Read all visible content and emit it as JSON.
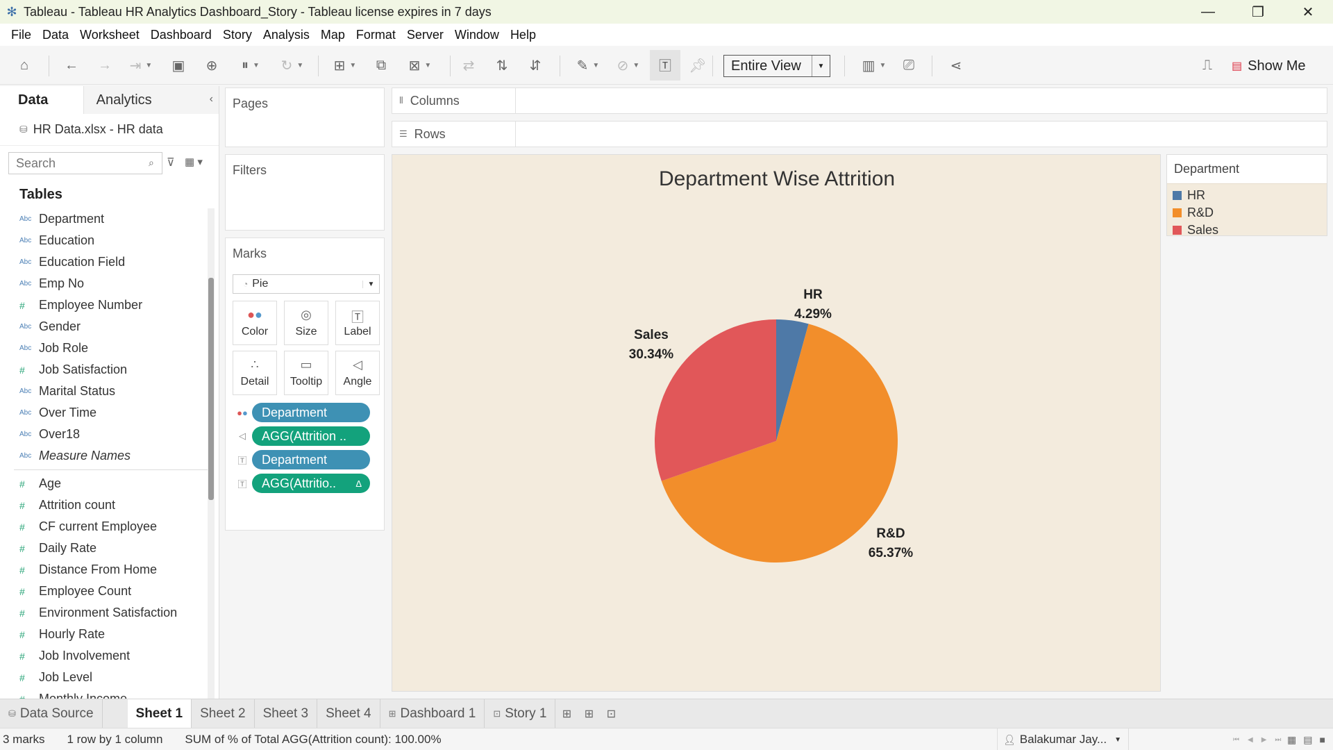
{
  "window": {
    "title": "Tableau - Tableau HR Analytics Dashboard_Story - Tableau license expires in 7 days"
  },
  "menu": [
    "File",
    "Data",
    "Worksheet",
    "Dashboard",
    "Story",
    "Analysis",
    "Map",
    "Format",
    "Server",
    "Window",
    "Help"
  ],
  "toolbar": {
    "fit_mode": "Entire View",
    "show_me": "Show Me"
  },
  "data_pane": {
    "tabs": [
      "Data",
      "Analytics"
    ],
    "data_source": "HR Data.xlsx - HR data",
    "search_placeholder": "Search",
    "tables_heading": "Tables",
    "dimensions": [
      {
        "type": "abc",
        "name": "Department"
      },
      {
        "type": "abc",
        "name": "Education"
      },
      {
        "type": "abc",
        "name": "Education Field"
      },
      {
        "type": "abc",
        "name": "Emp No"
      },
      {
        "type": "num",
        "name": "Employee Number"
      },
      {
        "type": "abc",
        "name": "Gender"
      },
      {
        "type": "abc",
        "name": "Job Role"
      },
      {
        "type": "num",
        "name": "Job Satisfaction"
      },
      {
        "type": "abc",
        "name": "Marital Status"
      },
      {
        "type": "abc",
        "name": "Over Time"
      },
      {
        "type": "abc",
        "name": "Over18"
      },
      {
        "type": "abc",
        "name": "Measure Names",
        "italic": true
      }
    ],
    "measures": [
      {
        "type": "num",
        "name": "Age"
      },
      {
        "type": "num",
        "name": "Attrition count"
      },
      {
        "type": "num",
        "name": "CF current Employee"
      },
      {
        "type": "num",
        "name": "Daily Rate"
      },
      {
        "type": "num",
        "name": "Distance From Home"
      },
      {
        "type": "num",
        "name": "Employee Count"
      },
      {
        "type": "num",
        "name": "Environment Satisfaction"
      },
      {
        "type": "num",
        "name": "Hourly Rate"
      },
      {
        "type": "num",
        "name": "Job Involvement"
      },
      {
        "type": "num",
        "name": "Job Level"
      },
      {
        "type": "num",
        "name": "Monthly Income"
      }
    ]
  },
  "cards": {
    "pages": "Pages",
    "filters": "Filters",
    "marks": "Marks",
    "mark_type": "Pie",
    "mark_buttons": [
      "Color",
      "Size",
      "Label",
      "Detail",
      "Tooltip",
      "Angle"
    ],
    "pills": [
      {
        "kind": "dim",
        "label": "Department",
        "icon": "color-icon"
      },
      {
        "kind": "meas",
        "label": "AGG(Attrition ..",
        "icon": "angle-icon"
      },
      {
        "kind": "dim",
        "label": "Department",
        "icon": "label-icon"
      },
      {
        "kind": "meas",
        "label": "AGG(Attritio..",
        "icon": "label-icon",
        "delta": "Δ"
      }
    ]
  },
  "shelves": {
    "columns": "Columns",
    "rows": "Rows"
  },
  "legend": {
    "title": "Department",
    "items": [
      {
        "label": "HR",
        "color": "#4e79a7"
      },
      {
        "label": "R&D",
        "color": "#f28e2b"
      },
      {
        "label": "Sales",
        "color": "#e15759"
      }
    ]
  },
  "chart_data": {
    "type": "pie",
    "title": "Department Wise Attrition",
    "categories": [
      "HR",
      "R&D",
      "Sales"
    ],
    "values": [
      4.29,
      65.37,
      30.34
    ],
    "value_labels": [
      "4.29%",
      "65.37%",
      "30.34%"
    ],
    "colors": [
      "#4e79a7",
      "#f28e2b",
      "#e15759"
    ],
    "legend_position": "right"
  },
  "sheet_tabs": {
    "data_source": "Data Source",
    "sheets": [
      "Sheet 1",
      "Sheet 2",
      "Sheet 3",
      "Sheet 4"
    ],
    "dashboards": [
      "Dashboard 1"
    ],
    "stories": [
      "Story 1"
    ],
    "active": "Sheet 1"
  },
  "status": {
    "marks": "3 marks",
    "dims": "1 row by 1 column",
    "sum": "SUM of % of Total AGG(Attrition count): 100.00%",
    "user": "Balakumar Jay..."
  }
}
